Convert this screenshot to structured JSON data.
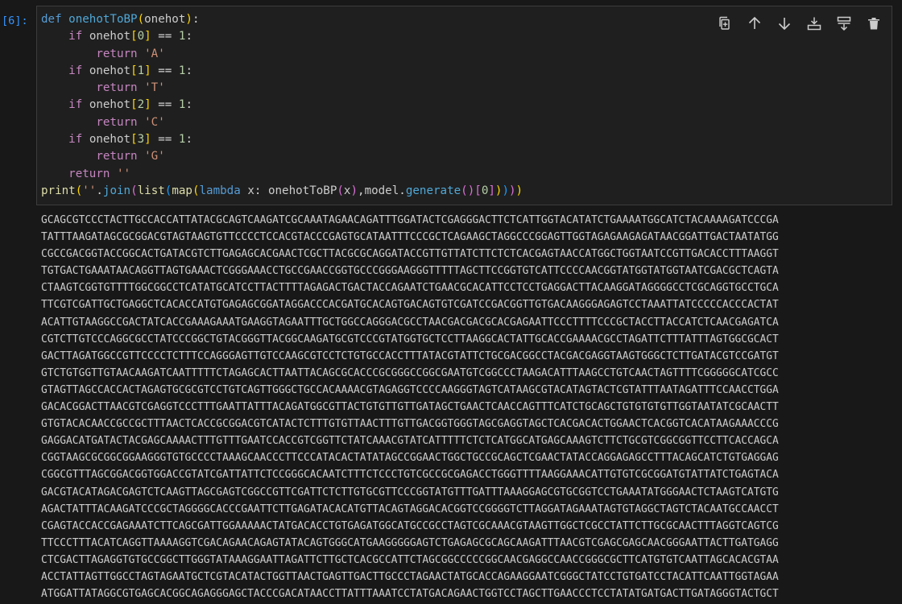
{
  "cell": {
    "execution_count": "[6]:",
    "tokens": {
      "def": "def",
      "fn_name": "onehotToBP",
      "param": "onehot",
      "colon": ":",
      "if": "if",
      "eq": "==",
      "one": "1",
      "return": "return",
      "empty_str": "''",
      "print": "print",
      "join": "join",
      "list": "list",
      "map": "map",
      "lambda": "lambda",
      "x": "x",
      "model": "model",
      "generate": "generate",
      "idx0": "0",
      "idx1": "1",
      "idx2": "2",
      "idx3": "3",
      "A": "'A'",
      "T": "'T'",
      "C": "'C'",
      "G": "'G'"
    }
  },
  "toolbar": {
    "icons": [
      "copy-icon",
      "arrow-up-icon",
      "arrow-down-icon",
      "insert-below-icon",
      "split-cell-icon",
      "trash-icon"
    ]
  },
  "output": {
    "lines": [
      "GCAGCGTCCCTACTTGCCACCATTATACGCAGTCAAGATCGCAAATAGAACAGATTTGGATACTCGAGGGACTTCTCATTGGTACATATCTGAAAATGGCATCTACAAAAGATCCCGA",
      "TATTTAAGATAGCGCGGACGTAGTAAGTGTTCCCCTCCACGTACCCGAGTGCATAATTTCCCGCTCAGAAGCTAGGCCCGGAGTTGGTAGAGAAGAGATAACGGATTGACTAATATGG",
      "CGCCGACGGTACCGGCACTGATACGTCTTGAGAGCACGAACTCGCTTACGCGCAGGATACCGTTGTTATCTTCTCTCACGAGTAACCATGGCTGGTAATCCGTTGACACCTTTAAGGT",
      "TGTGACTGAAATAACAGGTTAGTGAAACTCGGGAAACCTGCCGAACCGGTGCCCGGGAAGGGTTTTTAGCTTCCGGTGTCATTCCCCAACGGTATGGTATGGTAATCGACGCTCAGTA",
      "CTAAGTCGGTGTTTTGGCGGCCTCATATGCATCCTTACTTTTAGAGACTGACTACCAGAATCTGAACGCACATTCCTCCTGAGGACTTACAAGGATAGGGGCCTCGCAGGTGCCTGCA",
      "TTCGTCGATTGCTGAGGCTCACACCATGTGAGAGCGGATAGGACCCACGATGCACAGTGACAGTGTCGATCCGACGGTTGTGACAAGGGAGAGTCCTAAATTATCCCCCACCCACTAT",
      "ACATTGTAAGGCCGACTATCACCGAAAGAAATGAAGGTAGAATTTGCTGGCCAGGGACGCCTAACGACGACGCACGAGAATTCCCTTTTCCCGCTACCTTACCATCTCAACGAGATCA",
      "CGTCTTGTCCCAGGCGCCTATCCCGGCTGTACGGGTTACGGCAAGATGCGTCCCGTATGGTGCTCCTTAAGGCACTATTGCACCGAAAACGCCTAGATTCTTTATTTAGTGGCGCACT",
      "GACTTAGATGGCCGTTCCCCTCTTTCCAGGGAGTTGTCCAAGCGTCCTCTGTGCCACCTTTATACGTATTCTGCGACGGCCTACGACGAGGTAAGTGGGCTCTTGATACGTCCGATGT",
      "GTCTGTGGTTGTAACAAGATCAATTTTTCTAGAGCACTTAATTACAGCGCACCCGCGGGCCGGCGAATGTCGGCCCTAAGACATTTAAGCCTGTCAACTAGTTTTCGGGGGCATCGCC",
      "GTAGTTAGCCACCACTAGAGTGCGCGTCCTGTCAGTTGGGCTGCCACAAAACGTAGAGGTCCCCAAGGGTAGTCATAAGCGTACATAGTACTCGTATTTAATAGATTTCCAACCTGGA",
      "GACACGGACTTAACGTCGAGGTCCCTTTGAATTATTTACAGATGGCGTTACTGTGTTGTTGATAGCTGAACTCAACCAGTTTCATCTGCAGCTGTGTGTGTTGGTAATATCGCAACTT",
      "GTGTACACAACCGCCGCTTTAACTCACCGCGGACGTCATACTCTTTGTGTTAACTTTGTTGACGGTGGGTAGCGAGGTAGCTCACGACACTGGAACTCACGGTCACATAAGAAACCCG",
      "GAGGACATGATACTACGAGCAAAACTTTGTTTGAATCCACCGTCGGTTCTATCAAACGTATCATTTTTCTCTCATGGCATGAGCAAAGTCTTCTGCGTCGGCGGTTCCTTCACCAGCA",
      "CGGTAAGCGCGGCGGAAGGGTGTGCCCCTAAAGCAACCCTTCCCATACACTATATAGCCGGAACTGGCTGCCGCAGCTCGAACTATACCAGGAGAGCCTTTACAGCATCTGTGAGGAG",
      "CGGCGTTTAGCGGACGGTGGACCGTATCGATTATTCTCCGGGCACAATCTTTCTCCCTGTCGCCGCGAGACCTGGGTTTTAAGGAAACATTGTGTCGCGGATGTATTATCTGAGTACA",
      "GACGTACATAGACGAGTCTCAAGTTAGCGAGTCGGCCGTTCGATTCTCTTGTGCGTTCCCGGTATGTTTGATTTAAAGGAGCGTGCGGTCCTGAAATATGGGAACTCTAAGTCATGTG",
      "AGACTATTTACAAGATCCCGCTAGGGGCACCCGAATTCTTGAGATACACATGTTACAGTAGGACACGGTCCGGGGTCTTAGGATAGAAATAGTGTAGGCTAGTCTACAATGCCAACCT",
      "CGAGTACCACCGAGAAATCTTCAGCGATTGGAAAAACTATGACACCTGTGAGATGGCATGCCGCCTAGTCGCAAACGTAAGTTGGCTCGCCTATTCTTGCGCAACTTTAGGTCAGTCG",
      "TTCCCTTTACATCAGGTTAAAAGGTCGACAGAACAGAGTATACAGTGGGCATGAAGGGGGAGTCTGAGAGCGCAGCAAGATTTAACGTCGAGCGAGCAACGGGAATTACTTGATGAGG",
      "CTCGACTTAGAGGTGTGCCGGCTTGGGTATAAAGGAATTAGATTCTTGCTCACGCCATTCTAGCGGCCCCCGGCAACGAGGCCAACCGGGCGCTTCATGTGTCAATTAGCACACGTAA",
      "ACCTATTAGTTGGCCTAGTAGAATGCTCGTACATACTGGTTAACTGAGTTGACTTGCCCTAGAACTATGCACCAGAAGGAATCGGGCTATCCTGTGATCCTACATTCAATTGGTAGAA",
      "ATGGATTATAGGCGTGAGCACGGCAGAGGGAGCTACCCGACATAACCTTATTTAAATCCTATGACAGAACTGGTCCTAGCTTGAACCCTCCTATATGATGACTTGATAGGGTACTGCT"
    ]
  }
}
